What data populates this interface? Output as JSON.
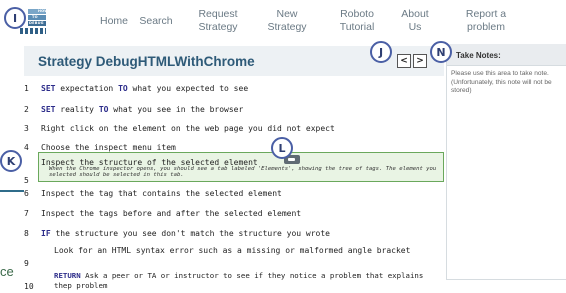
{
  "logo": {
    "line1": "HOW",
    "line2": "TO",
    "line3": "DEBUG"
  },
  "nav": {
    "items": [
      {
        "label": "Home"
      },
      {
        "label": "Search"
      },
      {
        "label": "Request\nStrategy"
      },
      {
        "label": "New\nStrategy"
      },
      {
        "label": "Roboto\nTutorial"
      },
      {
        "label": "About\nUs"
      },
      {
        "label": "Report a\nproblem"
      }
    ]
  },
  "callouts": {
    "logo": "I",
    "pager": "J",
    "step": "K",
    "help": "L",
    "notes": "N"
  },
  "strategy": {
    "title": "Strategy DebugHTMLWithChrome",
    "prev": "<",
    "next": ">",
    "steps": [
      {
        "num": "1",
        "kw1": "SET",
        "t1": " expectation ",
        "kw2": "TO",
        "t2": " what you expected to see"
      },
      {
        "num": "2",
        "kw1": "SET",
        "t1": " reality ",
        "kw2": "TO",
        "t2": " what you see in the browser"
      },
      {
        "num": "3",
        "text": "Right click on the element on the web page you did not expect"
      },
      {
        "num": "4",
        "text": "Choose the inspect menu item"
      },
      {
        "num": "5",
        "text": "Inspect the structure of the selected element",
        "note": "When the Chrome inspector opens, you should see a tab labeled 'Elements', showing the tree of tags. The element you selected should be selected in this tab."
      },
      {
        "num": "6",
        "text": "Inspect the tag that contains the selected element"
      },
      {
        "num": "7",
        "text": "Inspect the tags before and after the selected element"
      },
      {
        "num": "8",
        "kw1": "IF",
        "t1": " the structure you see don't match the structure you wrote"
      },
      {
        "num": "9",
        "text": "Look for an HTML syntax error such as a missing or malformed angle bracket"
      },
      {
        "num": "10",
        "kw1": "RETURN",
        "t1": " Ask a peer or TA or instructor to see if they notice a problem that explains thep problem"
      }
    ]
  },
  "notes": {
    "title": "Take Notes:",
    "placeholder": "Please use this area to take note. (Unfortunately, this note will not be stored)"
  },
  "edge": {
    "text": "ce"
  },
  "colors": {
    "title": "#2e5a78",
    "keyword": "#2c2c8a",
    "highlight_bg": "#e9f4e4",
    "highlight_border": "#6aa85c",
    "callout_ring": "#4a5fa5"
  }
}
